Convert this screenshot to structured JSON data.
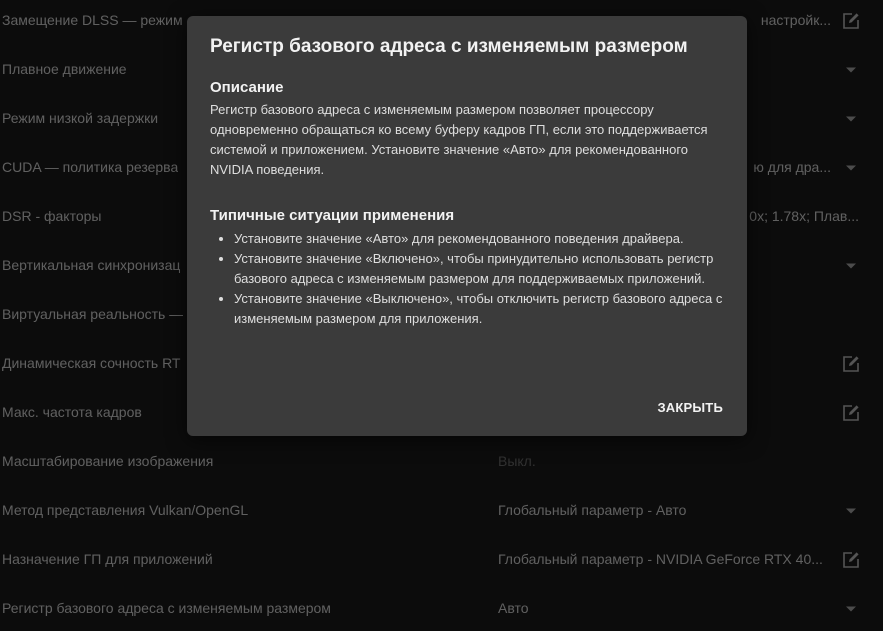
{
  "settings": {
    "rows": [
      {
        "label": "Замещение DLSS — режим",
        "value": "",
        "value_tail": "настройк...",
        "control": "edit"
      },
      {
        "label": "Плавное движение",
        "value": "",
        "control": "dropdown"
      },
      {
        "label": "Режим низкой задержки",
        "value": "",
        "control": "dropdown"
      },
      {
        "label": "CUDA — политика резерва",
        "value": "",
        "value_tail": "ю для дра...",
        "control": "dropdown"
      },
      {
        "label": "DSR - факторы",
        "value": "",
        "value_tail": "0x; 1.78x; Плав...",
        "control": "none"
      },
      {
        "label": "Вертикальная синхронизац",
        "value": "",
        "control": "dropdown"
      },
      {
        "label": "Виртуальная реальность —",
        "value": "",
        "control": "none"
      },
      {
        "label": "Динамическая сочность RT",
        "value": "",
        "control": "edit"
      },
      {
        "label": "Макс. частота кадров",
        "value": "",
        "control": "edit"
      },
      {
        "label": "Масштабирование изображения",
        "value": "Выкл.",
        "control": "none",
        "disabled": true
      },
      {
        "label": "Метод представления Vulkan/OpenGL",
        "value": "Глобальный параметр - Авто",
        "control": "dropdown"
      },
      {
        "label": "Назначение ГП для приложений",
        "value": "Глобальный параметр - NVIDIA GeForce RTX 40...",
        "control": "edit"
      },
      {
        "label": "Регистр базового адреса с изменяемым размером",
        "value": "Авто",
        "control": "dropdown"
      }
    ]
  },
  "dialog": {
    "title": "Регистр базового адреса с изменяемым размером",
    "description_heading": "Описание",
    "description": "Регистр базового адреса с изменяемым размером позволяет процессору одновременно обращаться ко всему буферу кадров ГП, если это поддерживается системой и приложением. Установите значение «Авто» для рекомендованного NVIDIA поведения.",
    "usage_heading": "Типичные ситуации применения",
    "usage_items": [
      "Установите значение «Авто» для рекомендованного поведения драйвера.",
      "Установите значение «Включено», чтобы принудительно использовать регистр базового адреса с изменяемым размером для поддерживаемых приложений.",
      "Установите значение «Выключено», чтобы отключить регистр базового адреса с изменяемым размером для приложения."
    ],
    "close_label": "ЗАКРЫТЬ"
  },
  "icons": {
    "edit": "edit-icon",
    "dropdown": "chevron-down-icon"
  },
  "colors": {
    "background": "#1b1b1b",
    "dialog": "#3b3b3b",
    "text": "#d6d6d6",
    "muted": "#6e6e6e"
  }
}
